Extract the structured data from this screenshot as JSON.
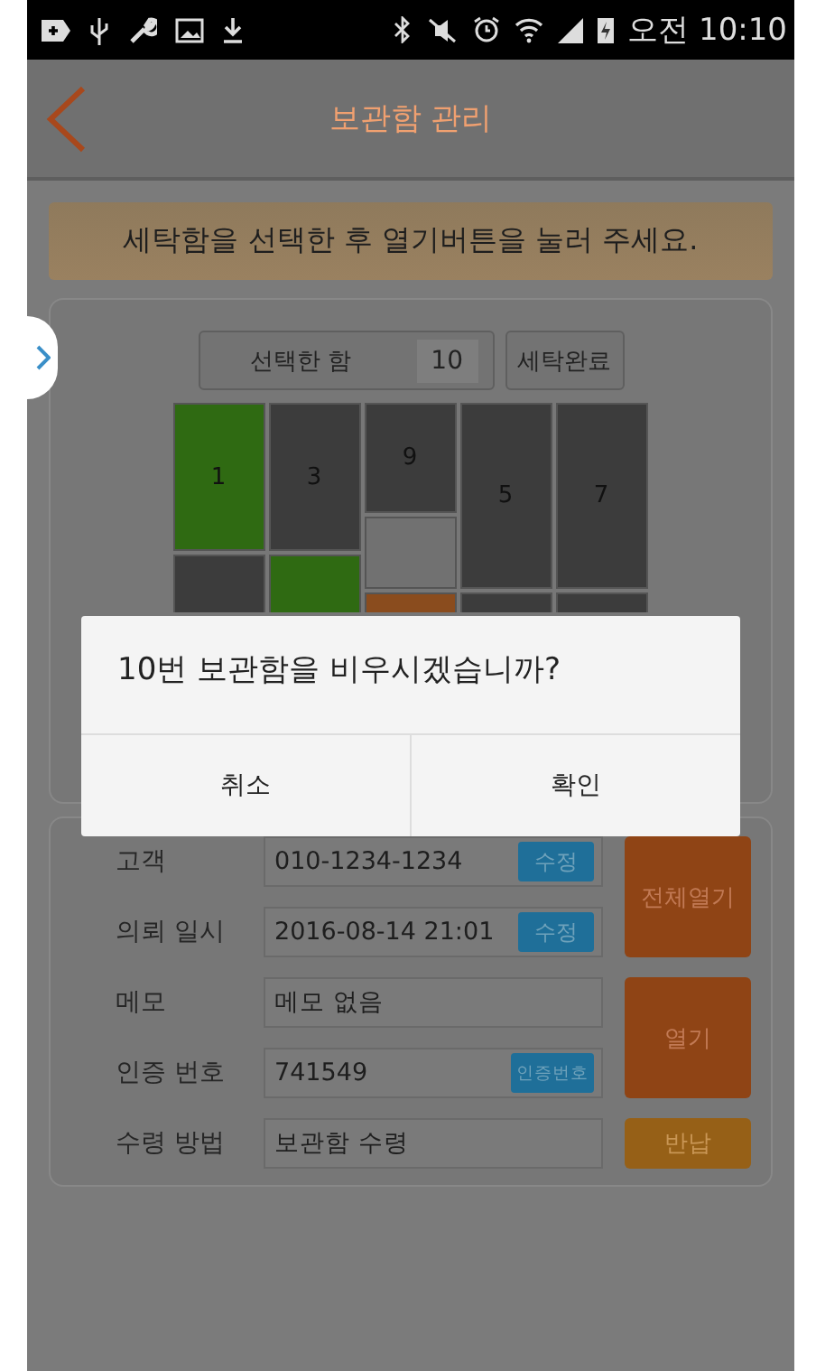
{
  "status_bar": {
    "time": "오전 10:10"
  },
  "header": {
    "title": "보관함 관리"
  },
  "banner": "세탁함을 선택한 후 열기버튼을 눌러 주세요.",
  "selected_box": {
    "label": "선택한 함",
    "value": "10"
  },
  "done_button": "세탁완료",
  "lockers": [
    {
      "label": "1",
      "color": "#2f6a12"
    },
    {
      "label": "3",
      "color": "#3c3c3c"
    },
    {
      "label": "9",
      "color": "#3c3c3c"
    },
    {
      "label": "5",
      "color": "#3c3c3c"
    },
    {
      "label": "7",
      "color": "#3c3c3c"
    },
    {
      "color": "#717171"
    },
    {
      "color": "#3c3c3c"
    },
    {
      "color": "#2f6a12"
    },
    {
      "color": "#8a4c1e"
    },
    {
      "color": "#3c3c3c"
    },
    {
      "color": "#3c3c3c"
    }
  ],
  "info_rows": [
    {
      "label": "고객",
      "value": "010-1234-1234",
      "action": "수정"
    },
    {
      "label": "의뢰 일시",
      "value": "2016-08-14 21:01",
      "action": "수정"
    },
    {
      "label": "메모",
      "value": "메모 없음"
    },
    {
      "label": "인증 번호",
      "value": "741549",
      "action": "인증번호"
    },
    {
      "label": "수령 방법",
      "value": "보관함 수령"
    }
  ],
  "side_buttons": [
    {
      "label": "전체열기",
      "kind": "tall"
    },
    {
      "label": "열기",
      "kind": "tall"
    },
    {
      "label": "반납",
      "kind": "short"
    }
  ],
  "dialog": {
    "message": "10번 보관함을 비우시겠습니까?",
    "buttons": [
      "취소",
      "확인"
    ]
  }
}
